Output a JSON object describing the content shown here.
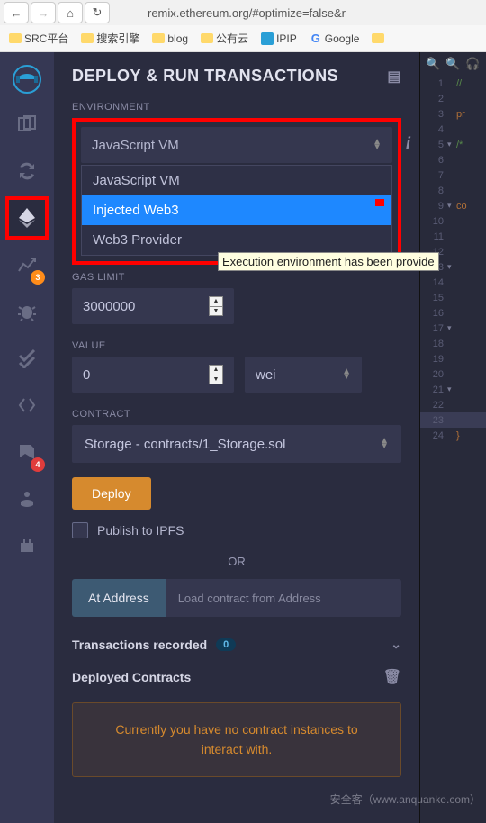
{
  "browser": {
    "url": "remix.ethereum.org/#optimize=false&r"
  },
  "bookmarks": [
    "SRC平台",
    "搜索引擎",
    "blog",
    "公有云",
    "IPIP",
    "Google"
  ],
  "panel": {
    "title": "DEPLOY & RUN TRANSACTIONS",
    "env_label": "ENVIRONMENT",
    "env_selected": "JavaScript VM",
    "env_options": [
      "JavaScript VM",
      "Injected Web3",
      "Web3 Provider"
    ],
    "tooltip": "Execution environment has been provide",
    "gas_label": "GAS LIMIT",
    "gas_value": "3000000",
    "value_label": "VALUE",
    "value_amount": "0",
    "value_unit": "wei",
    "contract_label": "CONTRACT",
    "contract_selected": "Storage - contracts/1_Storage.sol",
    "deploy": "Deploy",
    "publish": "Publish to IPFS",
    "or": "OR",
    "at_address": "At Address",
    "at_address_placeholder": "Load contract from Address",
    "tx_recorded": "Transactions recorded",
    "tx_count": "0",
    "deployed": "Deployed Contracts",
    "warn": "Currently you have no contract instances to interact with."
  },
  "sidebar": {
    "badge1": "3",
    "badge2": "4"
  },
  "watermark": "安全客（www.anquanke.com）",
  "editor": {
    "lines": [
      {
        "n": "1",
        "c": "//",
        "cls": "cm"
      },
      {
        "n": "2",
        "c": ""
      },
      {
        "n": "3",
        "c": "pr",
        "cls": "kw"
      },
      {
        "n": "4",
        "c": ""
      },
      {
        "n": "5",
        "c": "/*",
        "cls": "cm",
        "fold": "▾"
      },
      {
        "n": "6",
        "c": ""
      },
      {
        "n": "7",
        "c": ""
      },
      {
        "n": "8",
        "c": ""
      },
      {
        "n": "9",
        "c": "co",
        "cls": "kw",
        "fold": "▾"
      },
      {
        "n": "10",
        "c": ""
      },
      {
        "n": "11",
        "c": ""
      },
      {
        "n": "12",
        "c": ""
      },
      {
        "n": "13",
        "c": "",
        "fold": "▾"
      },
      {
        "n": "14",
        "c": ""
      },
      {
        "n": "15",
        "c": ""
      },
      {
        "n": "16",
        "c": ""
      },
      {
        "n": "17",
        "c": "",
        "fold": "▾"
      },
      {
        "n": "18",
        "c": ""
      },
      {
        "n": "19",
        "c": ""
      },
      {
        "n": "20",
        "c": ""
      },
      {
        "n": "21",
        "c": "",
        "fold": "▾"
      },
      {
        "n": "22",
        "c": ""
      },
      {
        "n": "23",
        "c": "",
        "hl": true
      },
      {
        "n": "24",
        "c": "}",
        "cls": ""
      }
    ]
  }
}
